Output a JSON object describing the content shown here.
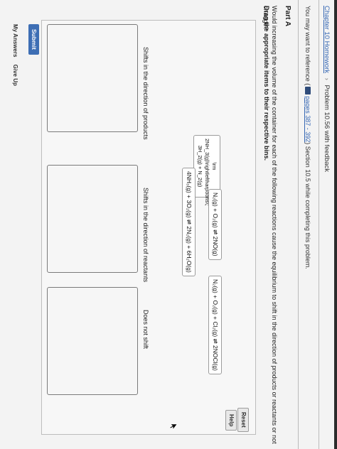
{
  "breadcrumb": {
    "chapter_link": "Chapter 10 Homework",
    "separator": "›",
    "problem_title": "Problem 10.56 with feedback"
  },
  "intro": {
    "prefix": "You may want to reference (",
    "ref_link": "pages 387 - 392",
    "suffix": ") Section 10.5 while completing this problem."
  },
  "part_a": {
    "heading": "Part A",
    "question": "Would increasing the volume of the container for each of the following reactions cause the equilibrium to shift in the direction of products or reactants or not change?",
    "instruction": "Drag the appropriate items to their respective bins."
  },
  "buttons": {
    "reset": "Reset",
    "help": "Help",
    "submit": "Submit"
  },
  "items": {
    "broken_image_text": "\\rm 2NH_3(g)\\rightleftharpoons\\; 3H_2(g) + N_2(g)",
    "n2_o2": "N₂(g) + O₂(g) ⇌ 2NO(g)",
    "n2_o2_cl2": "N₂(g) + O₂(g) + Cl₂(g) ⇌ 2NOCl(g)",
    "nh3_o2": "4NH₃(g) + 3O₂(g) ⇌ 2N₂(g) + 6H₂O(g)"
  },
  "bins": {
    "products": "Shifts in the direction of products",
    "reactants": "Shifts in the direction of reactants",
    "no_shift": "Does not shift"
  },
  "links": {
    "my_answers": "My Answers",
    "give_up": "Give Up"
  },
  "colors": {
    "link": "#3466b3",
    "submit_bg": "#3d6eb4"
  }
}
